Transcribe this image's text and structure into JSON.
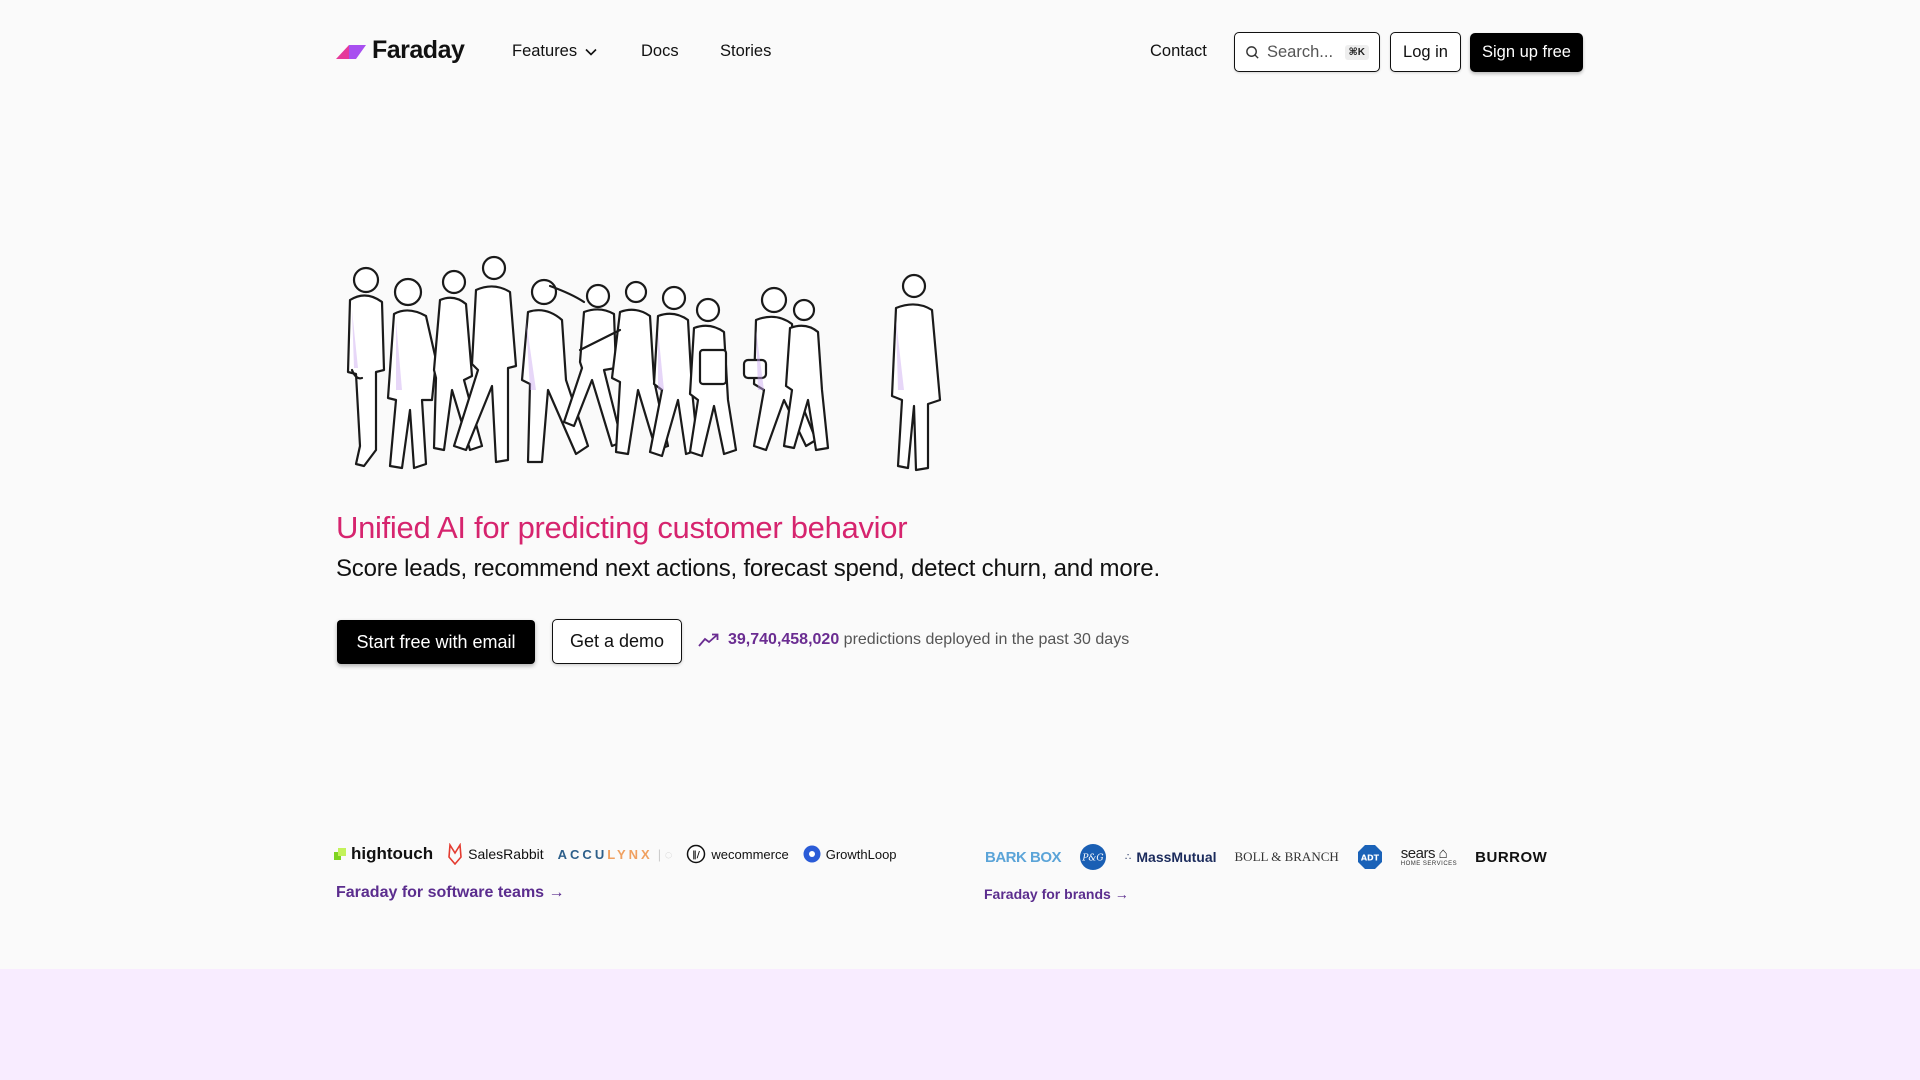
{
  "header": {
    "brand": "Faraday",
    "nav": [
      {
        "label": "Features",
        "has_dropdown": true
      },
      {
        "label": "Docs"
      },
      {
        "label": "Stories"
      }
    ],
    "contact_label": "Contact",
    "search": {
      "placeholder": "Search...",
      "shortcut": "⌘K"
    },
    "login_label": "Log in",
    "signup_label": "Sign up free"
  },
  "hero": {
    "illustration_alt": "Line drawing of a crowd of people walking",
    "headline": "Unified AI for predicting customer behavior",
    "subline": "Score leads, recommend next actions, forecast spend, detect churn, and more.",
    "cta_primary": "Start free with email",
    "cta_secondary": "Get a demo",
    "stat": {
      "icon": "trending-up-icon",
      "value": "39,740,458,020",
      "suffix": "predictions deployed in the past 30 days"
    }
  },
  "partners": {
    "software": {
      "logos": [
        "hightouch",
        "SalesRabbit",
        "ACCULYNX",
        "wecommerce",
        "GrowthLoop"
      ],
      "link": "Faraday for software teams →"
    },
    "brands": {
      "logos": [
        "BARK BOX",
        "P&G",
        "MassMutual",
        "BOLL & BRANCH",
        "ADT",
        "sears",
        "HOME SERVICES",
        "BURROW"
      ],
      "link": "Faraday for brands →"
    }
  },
  "colors": {
    "accent_pink": "#d6246e",
    "accent_purple": "#6a2c91",
    "page_bg": "#fafafa",
    "lavender_section": "#f8ecff"
  }
}
